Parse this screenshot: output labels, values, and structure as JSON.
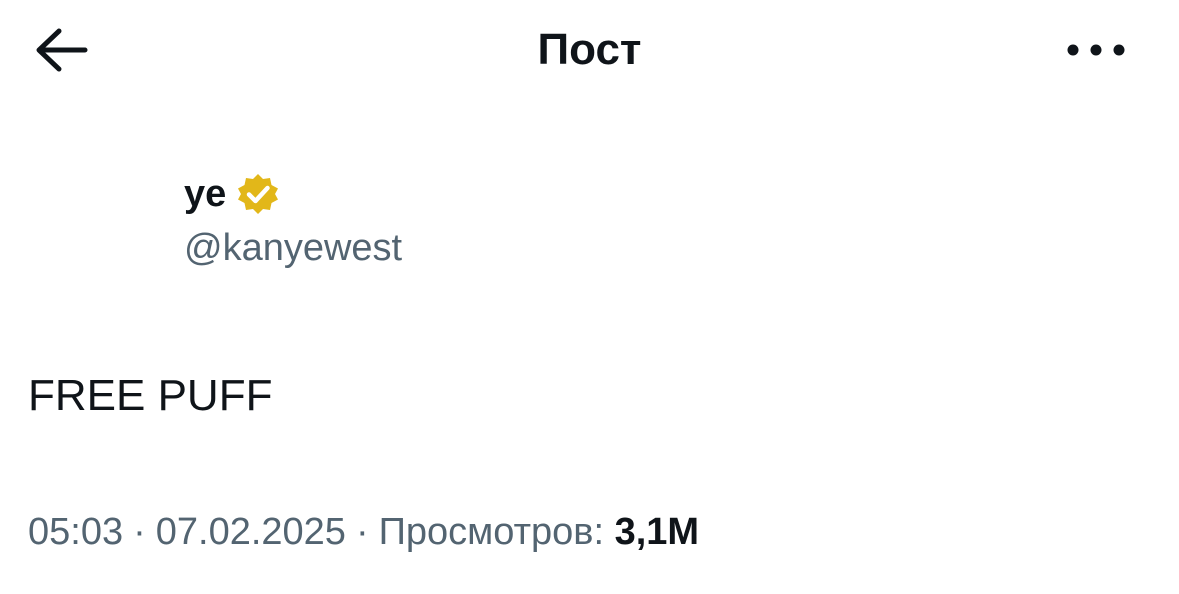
{
  "header": {
    "title": "Пост",
    "back_icon": "arrow-left-icon",
    "more_icon": "more-horizontal-icon"
  },
  "author": {
    "display_name": "ye",
    "handle": "@kanyewest",
    "verified_badge": "verified-badge-icon",
    "badge_color": "#E2B719"
  },
  "post": {
    "text": "FREE PUFF"
  },
  "meta": {
    "time": "05:03",
    "separator": "·",
    "date": "07.02.2025",
    "views_label": "Просмотров:",
    "views_count": "3,1M"
  },
  "colors": {
    "text_primary": "#0F1419",
    "text_secondary": "#536471",
    "background": "#FFFFFF"
  }
}
